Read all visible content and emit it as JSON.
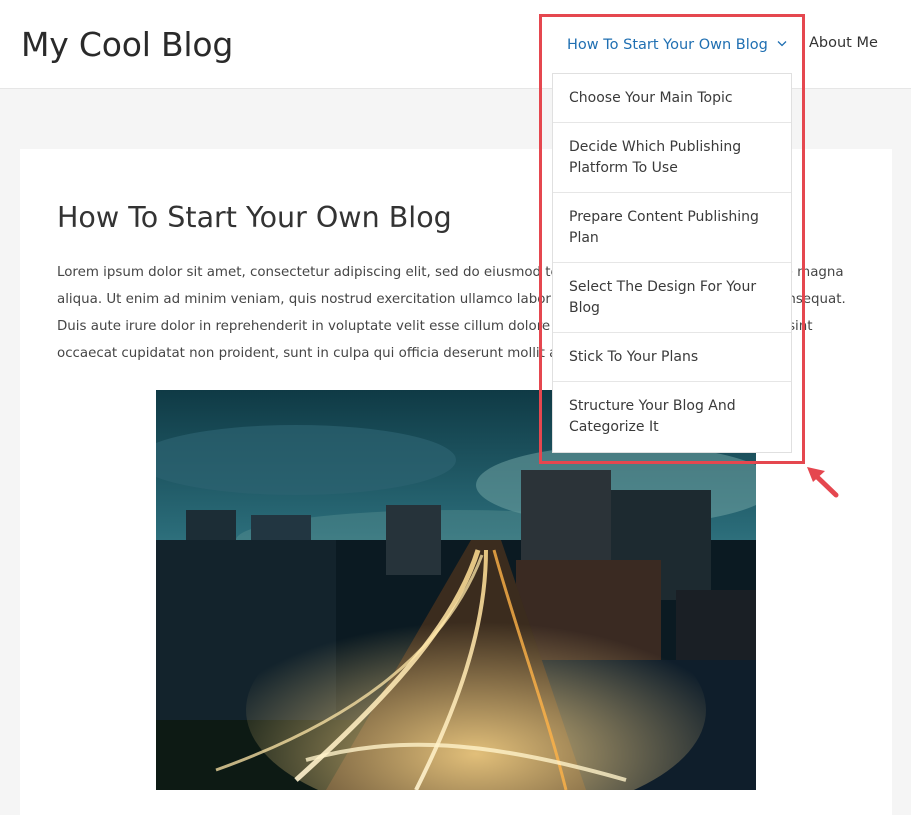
{
  "site": {
    "title": "My Cool Blog"
  },
  "nav": {
    "items": [
      {
        "label": "How To Start Your Own Blog",
        "active": true,
        "has_submenu": true
      },
      {
        "label": "About Me",
        "active": false,
        "has_submenu": false
      }
    ],
    "submenu_icon": "chevron-down-icon",
    "dropdown": [
      {
        "label": "Choose Your Main Topic"
      },
      {
        "label": "Decide Which Publishing Platform To Use"
      },
      {
        "label": "Prepare Content Publishing Plan"
      },
      {
        "label": "Select The Design For Your Blog"
      },
      {
        "label": "Stick To Your Plans"
      },
      {
        "label": "Structure Your Blog And Categorize It"
      }
    ]
  },
  "post": {
    "title": "How To Start Your Own Blog",
    "body": "Lorem ipsum dolor sit amet, consectetur adipiscing elit, sed do eiusmod tempor incididunt ut labore et dolore magna aliqua. Ut enim ad minim veniam, quis nostrud exercitation ullamco laboris nisi ut aliquip ex ea commodo consequat. Duis aute irure dolor in reprehenderit in voluptate velit esse cillum dolore eu fugiat nulla pariatur. Excepteur sint occaecat cupidatat non proident, sunt in culpa qui officia deserunt mollit anim id est laborum.",
    "image_description_icon": "city-night-image"
  },
  "colors": {
    "link_active": "#1f6fb2",
    "highlight": "#e5474f",
    "page_bg": "#f5f5f5"
  }
}
